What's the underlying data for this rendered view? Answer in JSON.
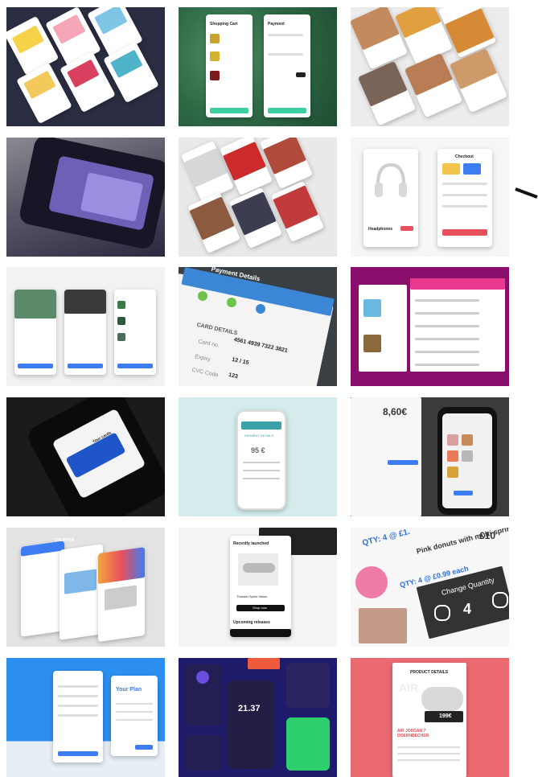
{
  "tiles": [
    {
      "name": "ecommerce-cards-collage",
      "bg": "#2b2d42"
    },
    {
      "name": "shopping-cart-payment",
      "bg": "#2f6b47",
      "texts": {
        "cart": "Shopping Cart",
        "payment": "Payment"
      }
    },
    {
      "name": "fashion-profiles",
      "bg": "#ececec"
    },
    {
      "name": "phone-card-dark",
      "bg": "#3c3558"
    },
    {
      "name": "fashion-social-feed",
      "bg": "#e9e9e9"
    },
    {
      "name": "headphones-checkout",
      "bg": "#f6f6f6",
      "texts": {
        "product": "Headphones",
        "checkout": "Checkout"
      }
    },
    {
      "name": "sneaker-shop-screens",
      "bg": "#f2f2f2"
    },
    {
      "name": "payment-details-steps",
      "bg": "#3a3f44",
      "texts": {
        "title": "Payment Details",
        "card_details": "CARD DETAILS",
        "card_no_label": "Card no.",
        "card_number": "4561 4939 7322 3821",
        "expiry_label": "Expiry",
        "expiry": "12 / 15",
        "cvc_label": "CVC Code",
        "cvc": "123"
      }
    },
    {
      "name": "grocery-list-magenta",
      "bg": "#8a0f6c"
    },
    {
      "name": "card-wallet-dark",
      "bg": "#1b1b1d",
      "texts": {
        "title": "Your cards"
      }
    },
    {
      "name": "phone-payment-mint",
      "bg": "#d5ecec",
      "texts": {
        "title": "PAYMENT DETAILS",
        "amount": "95 €"
      }
    },
    {
      "name": "amount-keypad-dark",
      "bg": "#3b3b3d",
      "texts": {
        "amount": "8,60€"
      }
    },
    {
      "name": "shopper-laptop-screens",
      "bg": "#e3e3e3",
      "texts": {
        "brand": "SHOPPER"
      }
    },
    {
      "name": "sneaker-launch",
      "bg": "#f5f5f5",
      "texts": {
        "heading": "Recently launched",
        "product": "Thunder Sprint Vision",
        "button": "Shop now",
        "upcoming": "Upcoming releases"
      }
    },
    {
      "name": "change-quantity-donuts",
      "bg": "#f7f7f7",
      "texts": {
        "qty1": "QTY: 4 @ £1.",
        "product": "Pink donuts with multi sprinkles",
        "qty2": "QTY: 4 @ £0.99 each",
        "dialog": "Change Quantity",
        "value": "4",
        "price": "£10"
      }
    },
    {
      "name": "your-plan-blue",
      "bg": "#2c8ff0",
      "texts": {
        "heading": "Your Plan"
      }
    },
    {
      "name": "timer-dark-purple",
      "bg": "#1f1b6b",
      "texts": {
        "time": "21.37"
      }
    },
    {
      "name": "product-details-red",
      "bg": "#ea6a70",
      "texts": {
        "header": "PRODUCT DETAILS",
        "title": "AIR JORDAN 7 DOERNBECHER",
        "price": "199€"
      }
    }
  ],
  "colors": {
    "accent_blue": "#3d7cf3",
    "accent_red": "#e94f5b",
    "accent_pink": "#ea3a8f",
    "accent_green": "#2ecf6d"
  }
}
